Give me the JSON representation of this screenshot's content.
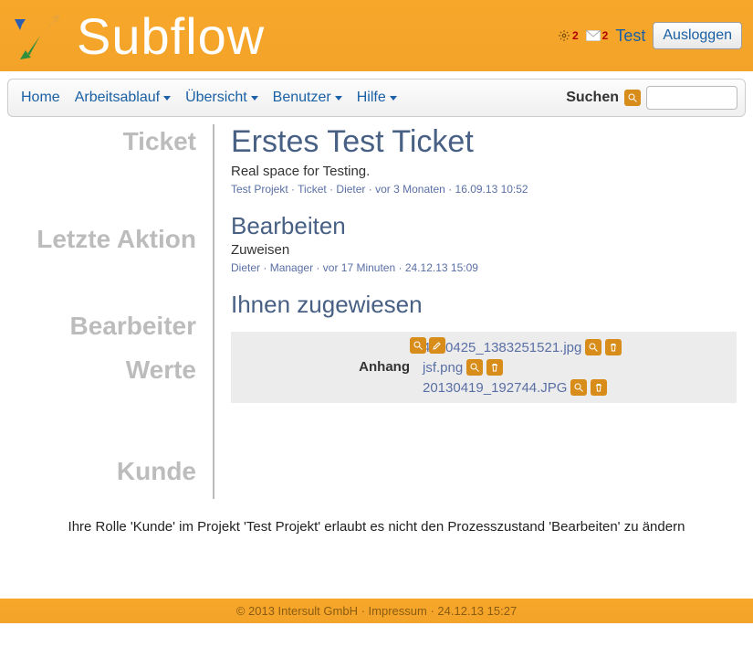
{
  "brand": "Subflow",
  "header": {
    "notif_gear_count": "2",
    "notif_mail_count": "2",
    "username": "Test",
    "logout_label": "Ausloggen"
  },
  "nav": {
    "home": "Home",
    "workflow": "Arbeitsablauf",
    "overview": "Übersicht",
    "users": "Benutzer",
    "help": "Hilfe",
    "search_label": "Suchen"
  },
  "sections": {
    "ticket": "Ticket",
    "last_action": "Letzte Aktion",
    "assignee": "Bearbeiter",
    "values": "Werte",
    "customer": "Kunde"
  },
  "ticket": {
    "title": "Erstes Test Ticket",
    "description": "Real space for Testing.",
    "meta_project": "Test Projekt",
    "meta_type": "Ticket",
    "meta_user": "Dieter",
    "meta_age": "vor 3 Monaten",
    "meta_time": "16.09.13 10:52"
  },
  "last_action": {
    "title": "Bearbeiten",
    "sub": "Zuweisen",
    "meta_user": "Dieter",
    "meta_role": "Manager",
    "meta_age": "vor 17 Minuten",
    "meta_time": "24.12.13 15:09"
  },
  "assignee_text": "Ihnen zugewiesen",
  "values": {
    "label": "Anhang",
    "attachments": [
      "4100425_1383251521.jpg",
      "jsf.png",
      "20130419_192744.JPG"
    ]
  },
  "message": "Ihre Rolle 'Kunde' im Projekt 'Test Projekt' erlaubt es nicht den Prozesszustand 'Bearbeiten' zu ändern",
  "footer": {
    "copyright": "© 2013 Intersult GmbH",
    "imprint": "Impressum",
    "time": "24.12.13 15:27"
  }
}
